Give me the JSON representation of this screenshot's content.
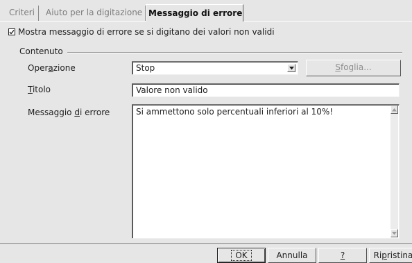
{
  "tabs": {
    "criteri": "Criteri",
    "aiuto": "Aiuto per la digitazione",
    "messaggio": "Messaggio di errore"
  },
  "checkbox": {
    "label": "Mostra messaggio di errore se si digitano dei valori non validi",
    "checked": true,
    "mark": "☑"
  },
  "group": {
    "label": "Contenuto"
  },
  "fields": {
    "operazione_label_pre": "Oper",
    "operazione_label_key": "a",
    "operazione_label_post": "zione",
    "operazione_value": "Stop",
    "sfoglia_key": "S",
    "sfoglia_rest": "foglia...",
    "titolo_key": "T",
    "titolo_rest": "itolo",
    "titolo_value": "Valore non valido",
    "messaggio_pre": "Messaggio ",
    "messaggio_key": "d",
    "messaggio_post": "i errore",
    "messaggio_value": "Si ammettono solo percentuali inferiori al 10%!"
  },
  "buttons": {
    "ok": "OK",
    "annulla": "Annulla",
    "help": "?",
    "ripristina_pre": "Ri",
    "ripristina_key": "p",
    "ripristina_post": "ristina"
  }
}
